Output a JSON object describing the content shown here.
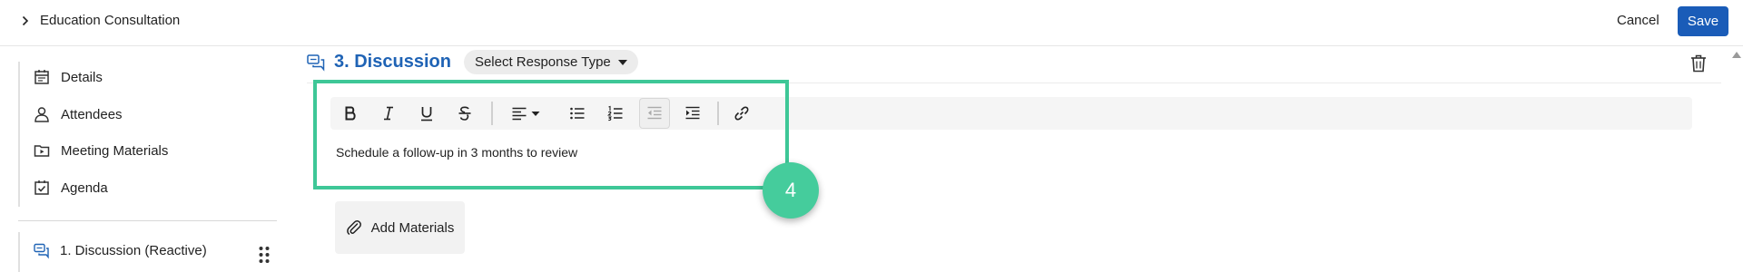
{
  "header": {
    "breadcrumb": "Education Consultation",
    "cancel_label": "Cancel",
    "save_label": "Save"
  },
  "sidebar": {
    "items": [
      {
        "label": "Details",
        "icon": "calendar-icon"
      },
      {
        "label": "Attendees",
        "icon": "person-icon"
      },
      {
        "label": "Meeting Materials",
        "icon": "folder-play-icon"
      },
      {
        "label": "Agenda",
        "icon": "calendar-check-icon"
      }
    ],
    "agenda_items": [
      {
        "label": "1. Discussion (Reactive)",
        "icon": "chat-icon"
      }
    ]
  },
  "section": {
    "title": "3. Discussion",
    "response_type_label": "Select Response Type"
  },
  "toolbar": {
    "buttons": [
      "bold",
      "italic",
      "underline",
      "strikethrough",
      "align",
      "bullet-list",
      "numbered-list",
      "outdent",
      "indent",
      "link"
    ]
  },
  "editor": {
    "content": "Schedule a follow-up in 3 months to review"
  },
  "materials": {
    "add_label": "Add Materials"
  },
  "callout": {
    "step_number": "4"
  },
  "colors": {
    "accent": "#1f63b5",
    "save_button": "#1a5cb8",
    "highlight": "#3ec797",
    "badge": "#45cc9c"
  }
}
